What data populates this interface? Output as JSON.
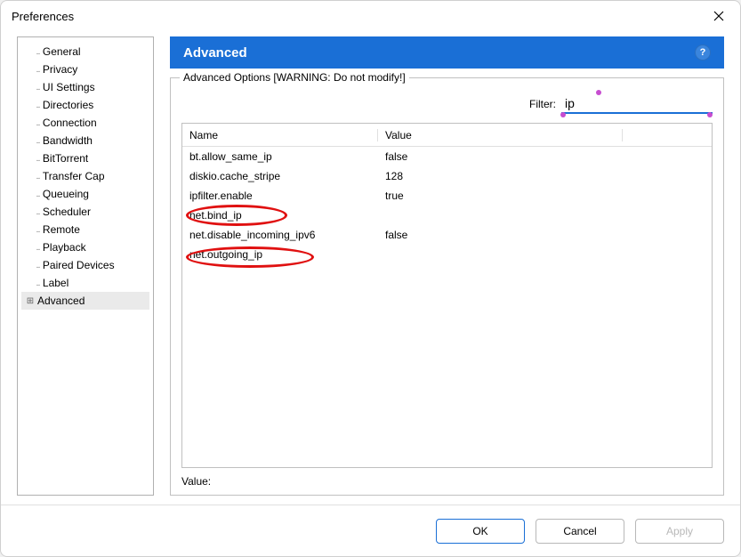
{
  "window": {
    "title": "Preferences"
  },
  "tree": {
    "items": [
      {
        "label": "General"
      },
      {
        "label": "Privacy"
      },
      {
        "label": "UI Settings"
      },
      {
        "label": "Directories"
      },
      {
        "label": "Connection"
      },
      {
        "label": "Bandwidth"
      },
      {
        "label": "BitTorrent"
      },
      {
        "label": "Transfer Cap"
      },
      {
        "label": "Queueing"
      },
      {
        "label": "Scheduler"
      },
      {
        "label": "Remote"
      },
      {
        "label": "Playback"
      },
      {
        "label": "Paired Devices"
      },
      {
        "label": "Label"
      },
      {
        "label": "Advanced"
      }
    ]
  },
  "section": {
    "title": "Advanced",
    "fieldset_legend": "Advanced Options [WARNING: Do not modify!]"
  },
  "filter": {
    "label": "Filter:",
    "value": "ip"
  },
  "table": {
    "headers": {
      "name": "Name",
      "value": "Value"
    },
    "rows": [
      {
        "name": "bt.allow_same_ip",
        "value": "false"
      },
      {
        "name": "diskio.cache_stripe",
        "value": "128"
      },
      {
        "name": "ipfilter.enable",
        "value": "true"
      },
      {
        "name": "net.bind_ip",
        "value": ""
      },
      {
        "name": "net.disable_incoming_ipv6",
        "value": "false"
      },
      {
        "name": "net.outgoing_ip",
        "value": ""
      }
    ]
  },
  "value_row": {
    "label": "Value:"
  },
  "buttons": {
    "ok": "OK",
    "cancel": "Cancel",
    "apply": "Apply"
  }
}
